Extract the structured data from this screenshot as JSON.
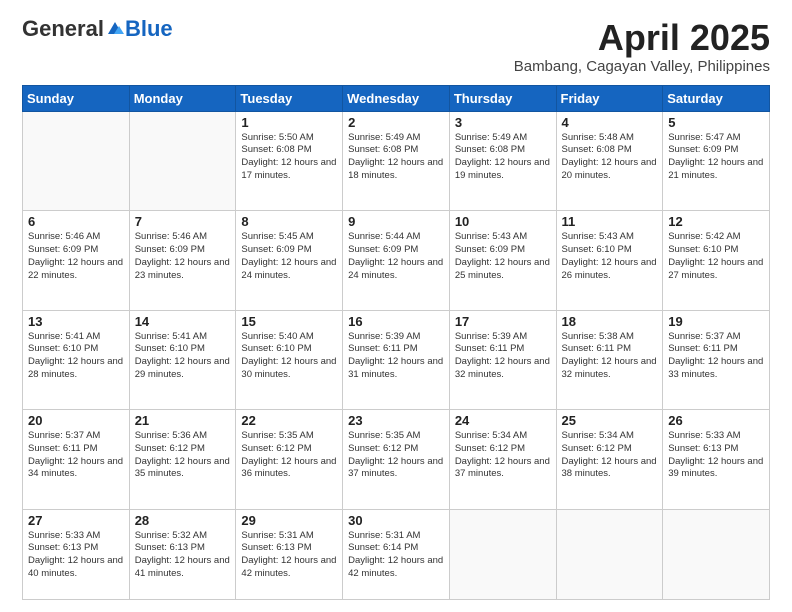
{
  "logo": {
    "general": "General",
    "blue": "Blue"
  },
  "title": {
    "month_year": "April 2025",
    "location": "Bambang, Cagayan Valley, Philippines"
  },
  "weekdays": [
    "Sunday",
    "Monday",
    "Tuesday",
    "Wednesday",
    "Thursday",
    "Friday",
    "Saturday"
  ],
  "days": [
    {
      "num": "",
      "info": ""
    },
    {
      "num": "",
      "info": ""
    },
    {
      "num": "1",
      "info": "Sunrise: 5:50 AM\nSunset: 6:08 PM\nDaylight: 12 hours and 17 minutes."
    },
    {
      "num": "2",
      "info": "Sunrise: 5:49 AM\nSunset: 6:08 PM\nDaylight: 12 hours and 18 minutes."
    },
    {
      "num": "3",
      "info": "Sunrise: 5:49 AM\nSunset: 6:08 PM\nDaylight: 12 hours and 19 minutes."
    },
    {
      "num": "4",
      "info": "Sunrise: 5:48 AM\nSunset: 6:08 PM\nDaylight: 12 hours and 20 minutes."
    },
    {
      "num": "5",
      "info": "Sunrise: 5:47 AM\nSunset: 6:09 PM\nDaylight: 12 hours and 21 minutes."
    },
    {
      "num": "6",
      "info": "Sunrise: 5:46 AM\nSunset: 6:09 PM\nDaylight: 12 hours and 22 minutes."
    },
    {
      "num": "7",
      "info": "Sunrise: 5:46 AM\nSunset: 6:09 PM\nDaylight: 12 hours and 23 minutes."
    },
    {
      "num": "8",
      "info": "Sunrise: 5:45 AM\nSunset: 6:09 PM\nDaylight: 12 hours and 24 minutes."
    },
    {
      "num": "9",
      "info": "Sunrise: 5:44 AM\nSunset: 6:09 PM\nDaylight: 12 hours and 24 minutes."
    },
    {
      "num": "10",
      "info": "Sunrise: 5:43 AM\nSunset: 6:09 PM\nDaylight: 12 hours and 25 minutes."
    },
    {
      "num": "11",
      "info": "Sunrise: 5:43 AM\nSunset: 6:10 PM\nDaylight: 12 hours and 26 minutes."
    },
    {
      "num": "12",
      "info": "Sunrise: 5:42 AM\nSunset: 6:10 PM\nDaylight: 12 hours and 27 minutes."
    },
    {
      "num": "13",
      "info": "Sunrise: 5:41 AM\nSunset: 6:10 PM\nDaylight: 12 hours and 28 minutes."
    },
    {
      "num": "14",
      "info": "Sunrise: 5:41 AM\nSunset: 6:10 PM\nDaylight: 12 hours and 29 minutes."
    },
    {
      "num": "15",
      "info": "Sunrise: 5:40 AM\nSunset: 6:10 PM\nDaylight: 12 hours and 30 minutes."
    },
    {
      "num": "16",
      "info": "Sunrise: 5:39 AM\nSunset: 6:11 PM\nDaylight: 12 hours and 31 minutes."
    },
    {
      "num": "17",
      "info": "Sunrise: 5:39 AM\nSunset: 6:11 PM\nDaylight: 12 hours and 32 minutes."
    },
    {
      "num": "18",
      "info": "Sunrise: 5:38 AM\nSunset: 6:11 PM\nDaylight: 12 hours and 32 minutes."
    },
    {
      "num": "19",
      "info": "Sunrise: 5:37 AM\nSunset: 6:11 PM\nDaylight: 12 hours and 33 minutes."
    },
    {
      "num": "20",
      "info": "Sunrise: 5:37 AM\nSunset: 6:11 PM\nDaylight: 12 hours and 34 minutes."
    },
    {
      "num": "21",
      "info": "Sunrise: 5:36 AM\nSunset: 6:12 PM\nDaylight: 12 hours and 35 minutes."
    },
    {
      "num": "22",
      "info": "Sunrise: 5:35 AM\nSunset: 6:12 PM\nDaylight: 12 hours and 36 minutes."
    },
    {
      "num": "23",
      "info": "Sunrise: 5:35 AM\nSunset: 6:12 PM\nDaylight: 12 hours and 37 minutes."
    },
    {
      "num": "24",
      "info": "Sunrise: 5:34 AM\nSunset: 6:12 PM\nDaylight: 12 hours and 37 minutes."
    },
    {
      "num": "25",
      "info": "Sunrise: 5:34 AM\nSunset: 6:12 PM\nDaylight: 12 hours and 38 minutes."
    },
    {
      "num": "26",
      "info": "Sunrise: 5:33 AM\nSunset: 6:13 PM\nDaylight: 12 hours and 39 minutes."
    },
    {
      "num": "27",
      "info": "Sunrise: 5:33 AM\nSunset: 6:13 PM\nDaylight: 12 hours and 40 minutes."
    },
    {
      "num": "28",
      "info": "Sunrise: 5:32 AM\nSunset: 6:13 PM\nDaylight: 12 hours and 41 minutes."
    },
    {
      "num": "29",
      "info": "Sunrise: 5:31 AM\nSunset: 6:13 PM\nDaylight: 12 hours and 42 minutes."
    },
    {
      "num": "30",
      "info": "Sunrise: 5:31 AM\nSunset: 6:14 PM\nDaylight: 12 hours and 42 minutes."
    },
    {
      "num": "",
      "info": ""
    },
    {
      "num": "",
      "info": ""
    },
    {
      "num": "",
      "info": ""
    },
    {
      "num": "",
      "info": ""
    }
  ]
}
